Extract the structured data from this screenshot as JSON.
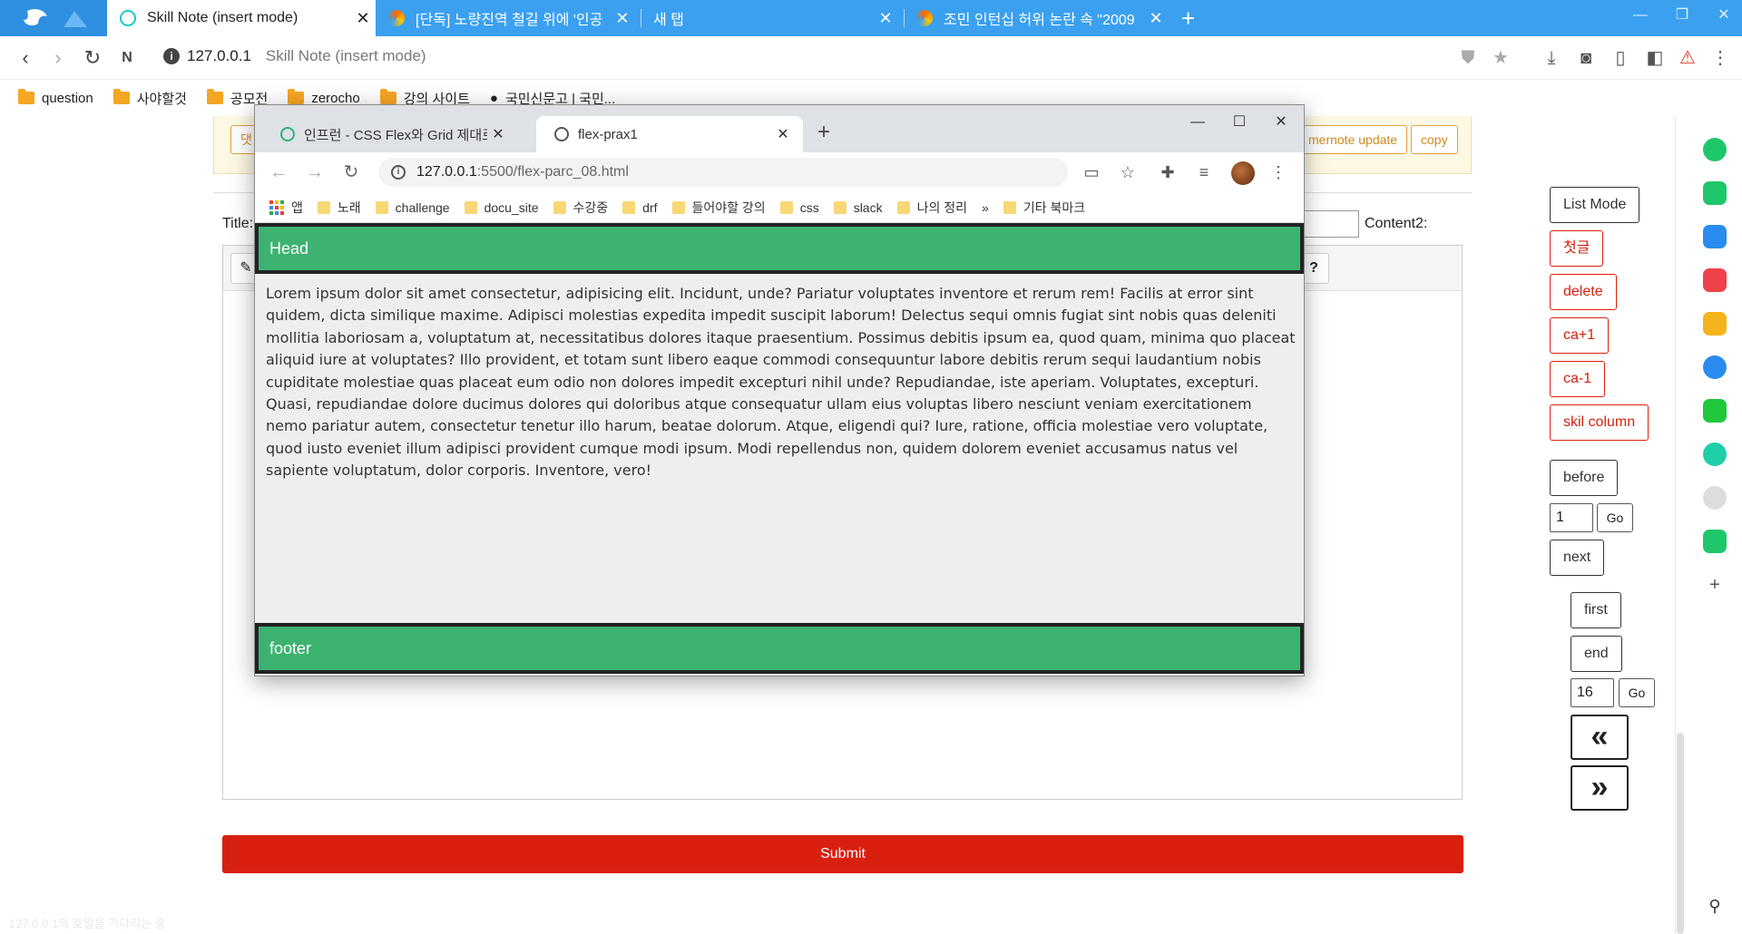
{
  "outer_browser": {
    "tabs": [
      {
        "title": "Skill Note (insert mode)",
        "active": true
      },
      {
        "title": "[단독] 노량진역 철길 위에 '인공"
      },
      {
        "title": "새 탭"
      },
      {
        "title": "조민 인턴십 허위 논란 속 \"2009"
      }
    ],
    "address": {
      "host": "127.0.0.1",
      "page_title": "Skill Note (insert mode)"
    },
    "bookmarks": [
      "question",
      "사야할것",
      "공모전",
      "zerocho",
      "강의 사이트",
      "국민신문고 | 국민..."
    ]
  },
  "page": {
    "notice_buttons": {
      "left_label": "댓",
      "update_label": "mernote update",
      "copy_label": "copy"
    },
    "title_label": "Title:",
    "content2_label": "Content2:",
    "submit_label": "Submit",
    "faded_text": "127.0.0.1의 호밀을 기다리는 중"
  },
  "right_panel": {
    "list_mode": "List Mode",
    "first_comment": "첫글",
    "delete": "delete",
    "ca_plus": "ca+1",
    "ca_minus": "ca-1",
    "skil_column": "skil column",
    "before": "before",
    "page_input_1": "1",
    "go1": "Go",
    "next": "next",
    "first": "first",
    "end": "end",
    "page_input_2": "16",
    "go2": "Go",
    "prev_icon": "«",
    "next_icon": "»"
  },
  "inner_browser": {
    "tabs": [
      {
        "title": "인프런 - CSS Flex와 Grid 제대로"
      },
      {
        "title": "flex-prax1",
        "active": true
      }
    ],
    "address": {
      "host": "127.0.0.1",
      "path": ":5500/flex-parc_08.html"
    },
    "bookmarks": [
      "앱",
      "노래",
      "challenge",
      "docu_site",
      "수강중",
      "drf",
      "들어야할 강의",
      "css",
      "slack",
      "나의 정리",
      "»",
      "기타 북마크"
    ],
    "content": {
      "head": "Head",
      "body": "Lorem ipsum dolor sit amet consectetur, adipisicing elit. Incidunt, unde? Pariatur voluptates inventore et rerum rem! Facilis at error sint quidem, dicta similique maxime. Adipisci molestias expedita impedit suscipit laborum! Delectus sequi omnis fugiat sint nobis quas deleniti mollitia laboriosam a, voluptatum at, necessitatibus dolores itaque praesentium. Possimus debitis ipsum ea, quod quam, minima quo placeat aliquid iure at voluptates? Illo provident, et totam sunt libero eaque commodi consequuntur labore debitis rerum sequi laudantium nobis cupiditate molestiae quas placeat eum odio non dolores impedit excepturi nihil unde? Repudiandae, iste aperiam. Voluptates, excepturi. Quasi, repudiandae dolore ducimus dolores qui doloribus atque consequatur ullam eius voluptas libero nesciunt veniam exercitationem nemo pariatur autem, consectetur tenetur illo harum, beatae dolorum. Atque, eligendi qui? Iure, ratione, officia molestiae vero voluptate, quod iusto eveniet illum adipisci provident cumque modi ipsum. Modi repellendus non, quidem dolorem eveniet accusamus natus vel sapiente voluptatum, dolor corporis. Inventore, vero!",
      "footer": "footer"
    }
  },
  "colors": {
    "tabbar": "#3aa0ef",
    "flex_green": "#3cb371",
    "submit_red": "#d9200f",
    "danger_red": "#d9200f"
  }
}
